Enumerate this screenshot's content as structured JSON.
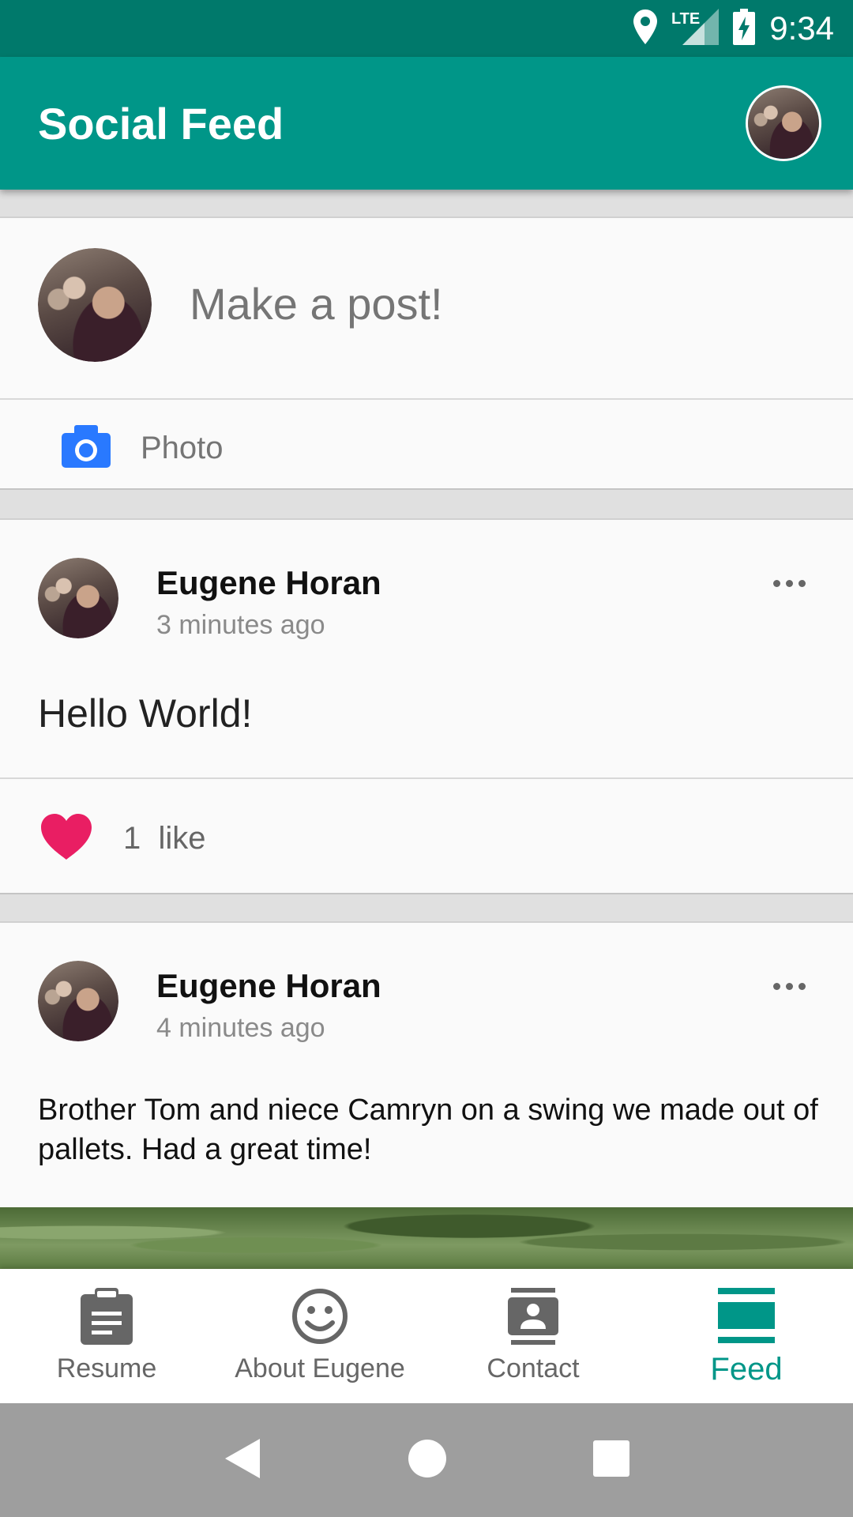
{
  "status_bar": {
    "network": "LTE",
    "time": "9:34"
  },
  "app_bar": {
    "title": "Social Feed"
  },
  "compose": {
    "placeholder": "Make a post!",
    "photo_label": "Photo"
  },
  "posts": [
    {
      "author": "Eugene Horan",
      "time": "3 minutes ago",
      "body": "Hello World!",
      "likes": "1",
      "likes_label": "like"
    },
    {
      "author": "Eugene Horan",
      "time": "4 minutes ago",
      "body": "Brother Tom and niece Camryn on a swing we made out of pallets. Had a great time!"
    }
  ],
  "bottom_nav": {
    "items": [
      {
        "label": "Resume",
        "icon": "clipboard-icon"
      },
      {
        "label": "About Eugene",
        "icon": "smiley-icon"
      },
      {
        "label": "Contact",
        "icon": "contact-card-icon"
      },
      {
        "label": "Feed",
        "icon": "feed-icon",
        "active": true
      }
    ]
  },
  "colors": {
    "primary": "#009688",
    "primary_dark": "#00796b",
    "like_red": "#e91e63",
    "camera_blue": "#2979ff"
  }
}
